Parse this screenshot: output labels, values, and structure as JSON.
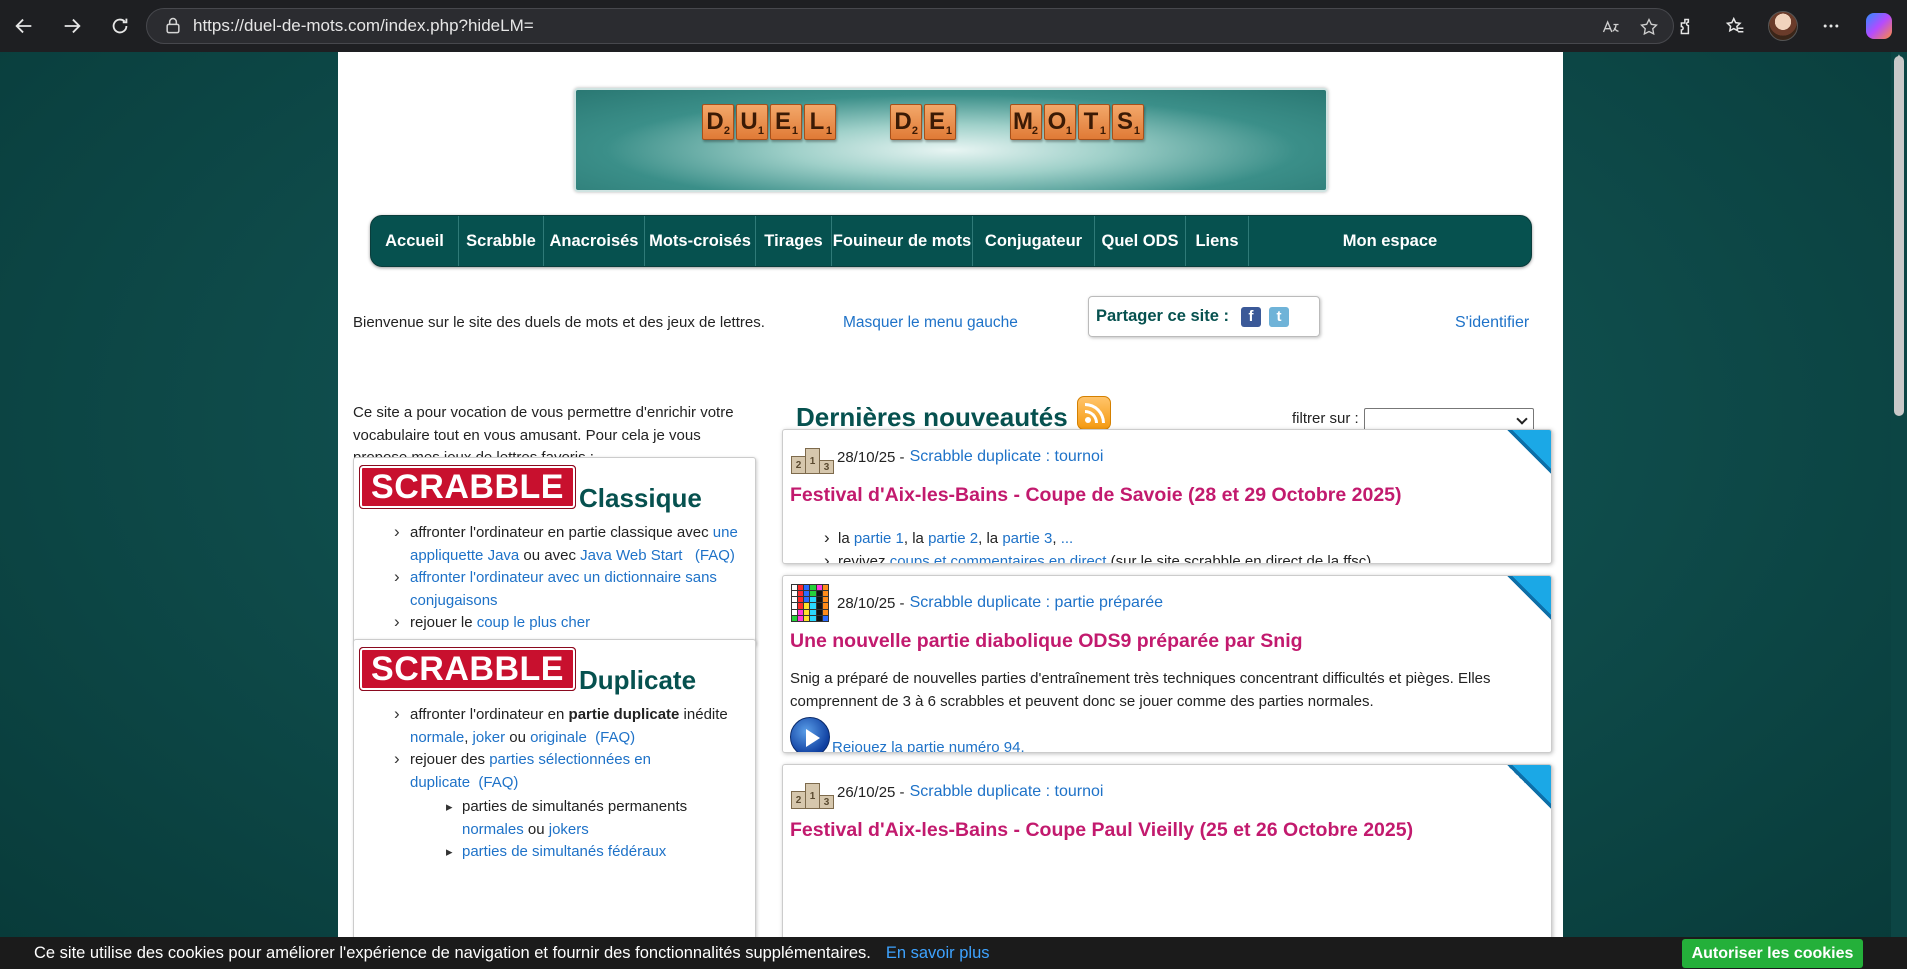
{
  "browser": {
    "url": "https://duel-de-mots.com/index.php?hideLM=",
    "back_icon": "back-arrow-icon",
    "forward_icon": "forward-arrow-icon",
    "reload_icon": "reload-icon"
  },
  "banner": {
    "words": [
      [
        {
          "l": "D",
          "v": "2"
        },
        {
          "l": "U",
          "v": "1"
        },
        {
          "l": "E",
          "v": "1"
        },
        {
          "l": "L",
          "v": "1"
        }
      ],
      [
        {
          "l": "D",
          "v": "2"
        },
        {
          "l": "E",
          "v": "1"
        }
      ],
      [
        {
          "l": "M",
          "v": "2"
        },
        {
          "l": "O",
          "v": "1"
        },
        {
          "l": "T",
          "v": "1"
        },
        {
          "l": "S",
          "v": "1"
        }
      ]
    ]
  },
  "menu": {
    "items": [
      "Accueil",
      "Scrabble",
      "Anacroisés",
      "Mots-croisés",
      "Tirages",
      "Fouineur de mots",
      "Conjugateur",
      "Quel ODS",
      "Liens",
      "Mon espace"
    ]
  },
  "info": {
    "welcome": "Bienvenue sur le site des duels de mots et des jeux de lettres.",
    "hide_menu": "Masquer le menu gauche",
    "share_label": "Partager ce site :",
    "facebook": "f",
    "twitter": "t",
    "login": "S'identifier"
  },
  "left": {
    "intro": "Ce site a pour vocation de vous permettre d'enrichir votre vocabulaire tout en vous amusant. Pour cela je vous propose mes jeux de lettres favoris :",
    "scrabble_logo": "SCRABBLE",
    "classique": {
      "title": "Classique",
      "i1_pre": "affronter l'ordinateur en partie classique avec ",
      "i1_link1": "une appliquette Java",
      "i1_mid": " ou avec ",
      "i1_link2": "Java Web Start",
      "i1_faq": "(FAQ)",
      "i2_link": "affronter l'ordinateur avec un dictionnaire sans conjugaisons",
      "i3_pre": "rejouer le ",
      "i3_link": "coup le plus cher"
    },
    "duplicate": {
      "title": "Duplicate",
      "i1_pre": "affronter l'ordinateur en ",
      "i1_bold": "partie duplicate",
      "i1_post": " inédite",
      "i1_l1": "normale",
      "i1_sep1": ", ",
      "i1_l2": "joker",
      "i1_sep2": " ou ",
      "i1_l3": "originale",
      "i1_faq": "(FAQ)",
      "i2_pre": "rejouer des ",
      "i2_link": "parties sélectionnées en duplicate",
      "i2_faq": "(FAQ)",
      "s1_text": "parties de simultanés permanents",
      "s1_l1": "normales",
      "s1_sep": " ou ",
      "s1_l2": "jokers",
      "s2_link": "parties de simultanés fédéraux"
    }
  },
  "news": {
    "title": "Dernières nouveautés",
    "filter_label": "filtrer sur :",
    "filter_value": "",
    "cards": [
      {
        "date": "28/10/25 -",
        "category": "Scrabble duplicate : tournoi",
        "title": "Festival d'Aix-les-Bains - Coupe de Savoie (28 et 29 Octobre 2025)",
        "l1_a": "la ",
        "l1_p1": "partie 1",
        "l1_b": ", la ",
        "l1_p2": "partie 2",
        "l1_c": ", la ",
        "l1_p3": "partie 3",
        "l1_d": ", ",
        "l1_more": "...",
        "l2_a": "revivez ",
        "l2_link": "coups et commentaires en direct",
        "l2_b": " (sur le site scrabble en direct de la ffsc)"
      },
      {
        "date": "28/10/25 -",
        "category": "Scrabble duplicate : partie préparée",
        "title": "Une nouvelle partie diabolique ODS9 préparée par Snig",
        "body": "Snig a préparé de nouvelles parties d'entraînement très techniques concentrant difficultés et pièges. Elles comprennent de 3 à 6 scrabbles et peuvent donc se jouer comme des parties normales.",
        "play_link": "Rejouez la partie numéro 94."
      },
      {
        "date": "26/10/25 -",
        "category": "Scrabble duplicate : tournoi",
        "title": "Festival d'Aix-les-Bains - Coupe Paul Vieilly (25 et 26 Octobre 2025)"
      }
    ]
  },
  "cookie": {
    "text": "Ce site utilise des cookies pour améliorer l'expérience de navigation et fournir des fonctionnalités supplémentaires.",
    "more": "En savoir plus",
    "accept": "Autoriser les cookies"
  },
  "colors": {
    "teal": "#06514f",
    "link": "#1e72c8",
    "headline": "#c21a6e",
    "scrabble_red": "#c8102e",
    "cookie_green": "#24b03a"
  }
}
